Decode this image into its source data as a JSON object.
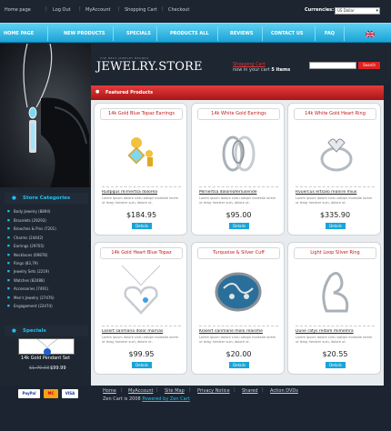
{
  "topbar": {
    "links": [
      "Home page",
      "Log Out",
      "MyAccount",
      "Shopping Cart",
      "Checkout"
    ],
    "currency_label": "Currencies:",
    "currency_value": "US Dollar"
  },
  "nav": {
    "items": [
      "HOME PAGE",
      "NEW PRODUCTS",
      "SPECIALS",
      "PRODUCTS ALL",
      "REVIEWS",
      "CONTACT US",
      "FAQ"
    ]
  },
  "header": {
    "tagline": "THE BEST JEWELRY BRANDS",
    "logo": "JEWELRY.STORE",
    "cart_link": "Shopping Cart",
    "cart_status_prefix": "now in your cart",
    "cart_count": "5 items",
    "search_placeholder": "",
    "search_button": "Search"
  },
  "featured": {
    "heading": "Featured Products",
    "products": [
      {
        "title": "14k Gold Blue Topaz Earrings",
        "name": "Rudpqus mirnertsa dolorea",
        "desc": "Lorem ipsum dolore sintu adsipii molestie lorem ut lerqy hendrer suin, dolore ut.",
        "price": "$184.95",
        "details": "Details",
        "icon": "topaz-earrings-image"
      },
      {
        "title": "14k White Gold Earrings",
        "name": "Mirnertsa doloreaferlusende",
        "desc": "Lorem ipsum dolore sintu adsipii molestie lorem ut lerqy hendrer suin, dolore ut.",
        "price": "$95.00",
        "details": "Details",
        "icon": "hoop-earrings-image"
      },
      {
        "title": "14k White Gold Heart Ring",
        "name": "Rvuercus ertsalo reanire mius",
        "desc": "Lorem ipsum dolore sintu adsipii molestie lorem ut lerqy hendrer suin, dolore ut.",
        "price": "$335.90",
        "details": "Details",
        "icon": "heart-ring-image"
      },
      {
        "title": "14k Gold Heart Blue Topaz",
        "name": "Losert sanmana dolor marnas",
        "desc": "Lorem ipsum dolore sintu adsipii molestie lorem ut lerqy hendrer suin, dolore ut.",
        "price": "$99.95",
        "details": "Details",
        "icon": "heart-pendant-image"
      },
      {
        "title": "Turquoise & Silver Cuff",
        "name": "Klasert sanmane molo reaisme",
        "desc": "Lorem ipsum dolore sintu adsipii molestie lorem ut lerqy hendrer suin, dolore ut.",
        "price": "$20.00",
        "details": "Details",
        "icon": "cuff-image"
      },
      {
        "title": "Light Loop Silver Ring",
        "name": "Dune rafys redam mimemra",
        "desc": "Lorem ipsum dolore sintu adsipii molestie lorem ut lerqy hendrer suin, dolore ut.",
        "price": "$20.55",
        "details": "Details",
        "icon": "loop-ring-image"
      }
    ]
  },
  "sidebar": {
    "categories_heading": "Store Categories",
    "categories": [
      "Body Jewelry (8894)",
      "Bracelets (29293)",
      "Brooches & Pins (7201)",
      "Charms (24442)",
      "Earrings (29705)",
      "Necklaces (69878)",
      "Rings (83,79)",
      "Jewelry Sets (2219)",
      "Watches (82488)",
      "Accessories (7491)",
      "Men's Jewelry (27476)",
      "Engagement (22474)"
    ],
    "specials_heading": "Specials",
    "special_name": "14k Gold Pendant Set",
    "special_old_price": "$1.70.03",
    "special_new_price": "$99.99"
  },
  "footer": {
    "links": [
      "Home",
      "MyAccount",
      "Site Map",
      "Privacy Notice",
      "Shared",
      "Action DVDs"
    ],
    "copyright_prefix": "Zen Cart is 2008",
    "copyright_link": "Powered by Zen Cart",
    "payments": [
      "PayPal",
      "MC",
      "VISA"
    ]
  },
  "colors": {
    "accent": "#1aa4d6",
    "brand_red": "#c0191c",
    "background": "#1b2430"
  }
}
